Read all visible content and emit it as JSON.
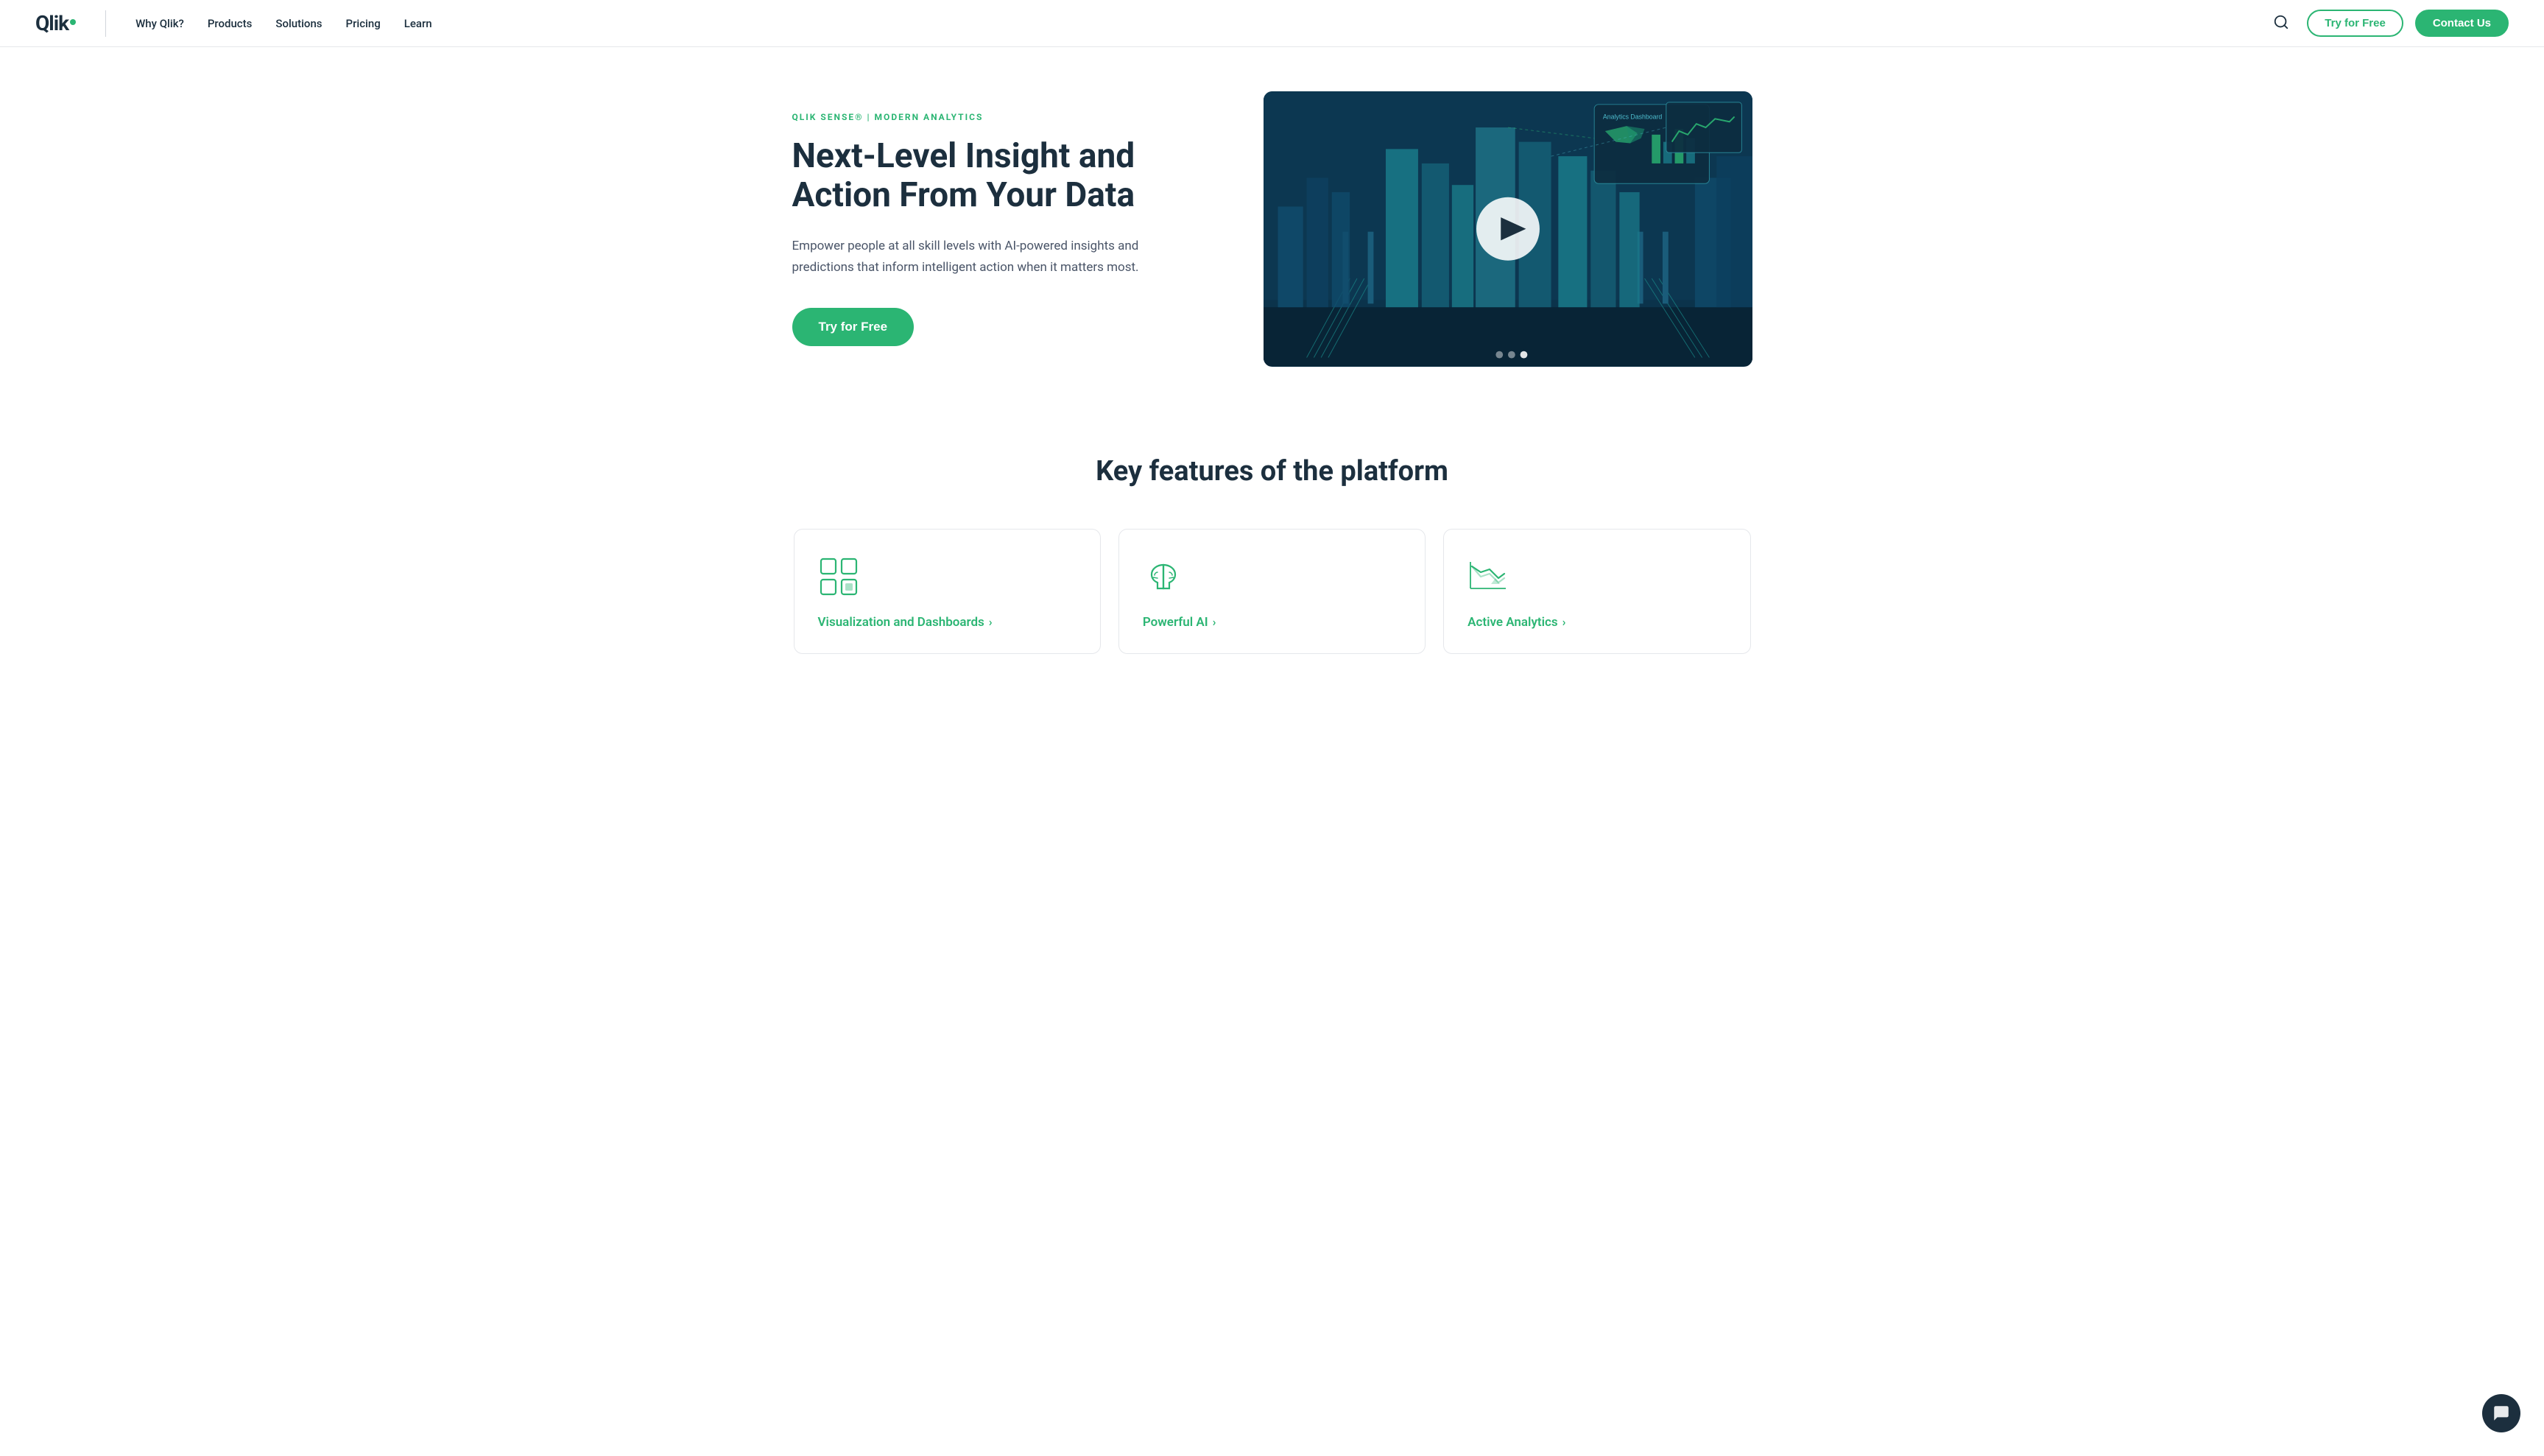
{
  "brand": {
    "name": "Qlik",
    "logo_text": "Qlik"
  },
  "nav": {
    "links": [
      {
        "id": "why-qlik",
        "label": "Why Qlik?"
      },
      {
        "id": "products",
        "label": "Products"
      },
      {
        "id": "solutions",
        "label": "Solutions"
      },
      {
        "id": "pricing",
        "label": "Pricing"
      },
      {
        "id": "learn",
        "label": "Learn"
      }
    ],
    "try_free_label": "Try for Free",
    "contact_label": "Contact Us"
  },
  "hero": {
    "eyebrow": "QLIK SENSE® | MODERN ANALYTICS",
    "title": "Next-Level Insight and Action From Your Data",
    "description": "Empower people at all skill levels with AI-powered insights and predictions that inform intelligent action when it matters most.",
    "cta_label": "Try for Free"
  },
  "features": {
    "section_title": "Key features of the platform",
    "cards": [
      {
        "id": "viz",
        "icon": "dashboard-icon",
        "label": "Visualization and Dashboards",
        "link_arrow": "›"
      },
      {
        "id": "ai",
        "icon": "brain-icon",
        "label": "Powerful AI",
        "link_arrow": "›"
      },
      {
        "id": "analytics",
        "icon": "analytics-icon",
        "label": "Active Analytics",
        "link_arrow": "›"
      }
    ]
  },
  "video": {
    "play_label": "Play video",
    "dots": [
      false,
      false,
      true
    ]
  },
  "chat": {
    "label": "Open chat"
  }
}
